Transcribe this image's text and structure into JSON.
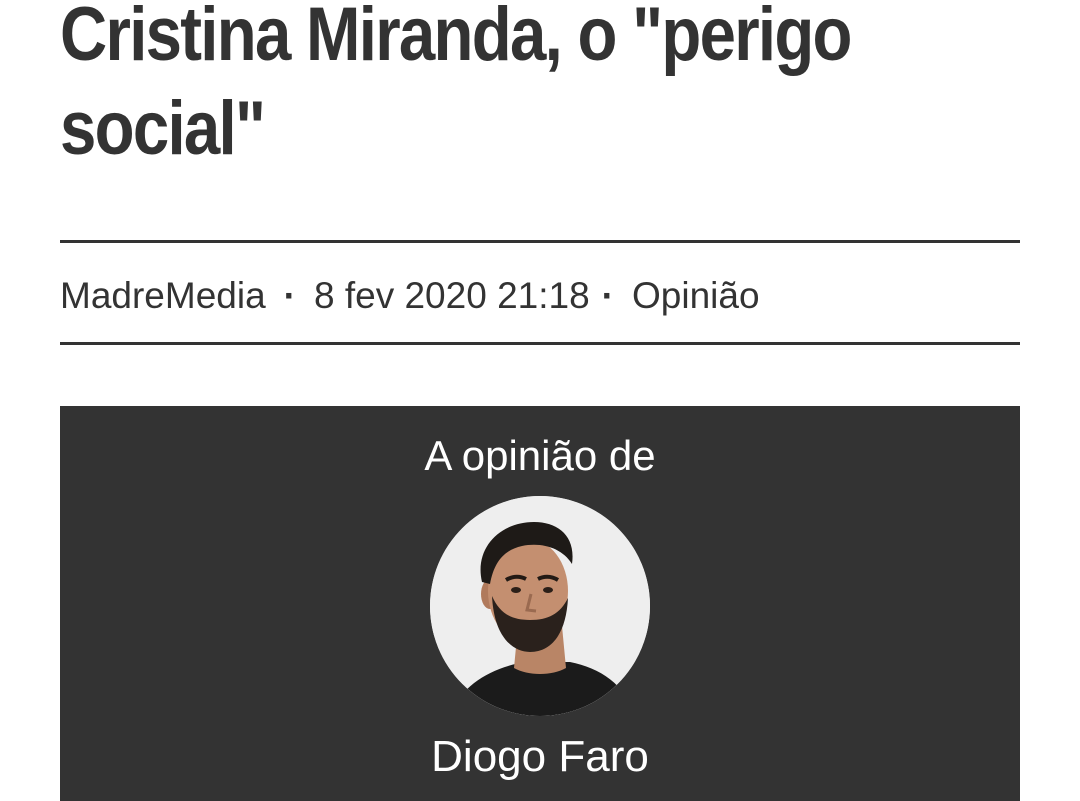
{
  "article": {
    "title": "Cristina Miranda, o \"perigo social\"",
    "publisher": "MadreMedia",
    "separator": "·",
    "date": "8 fev 2020 21:18",
    "category": "Opinião"
  },
  "opinion_box": {
    "label": "A opinião de",
    "author_name": "Diogo Faro",
    "avatar_icon": "author-portrait"
  },
  "colors": {
    "text": "#333333",
    "box_background": "#333333",
    "box_text": "#ffffff",
    "background": "#ffffff"
  }
}
